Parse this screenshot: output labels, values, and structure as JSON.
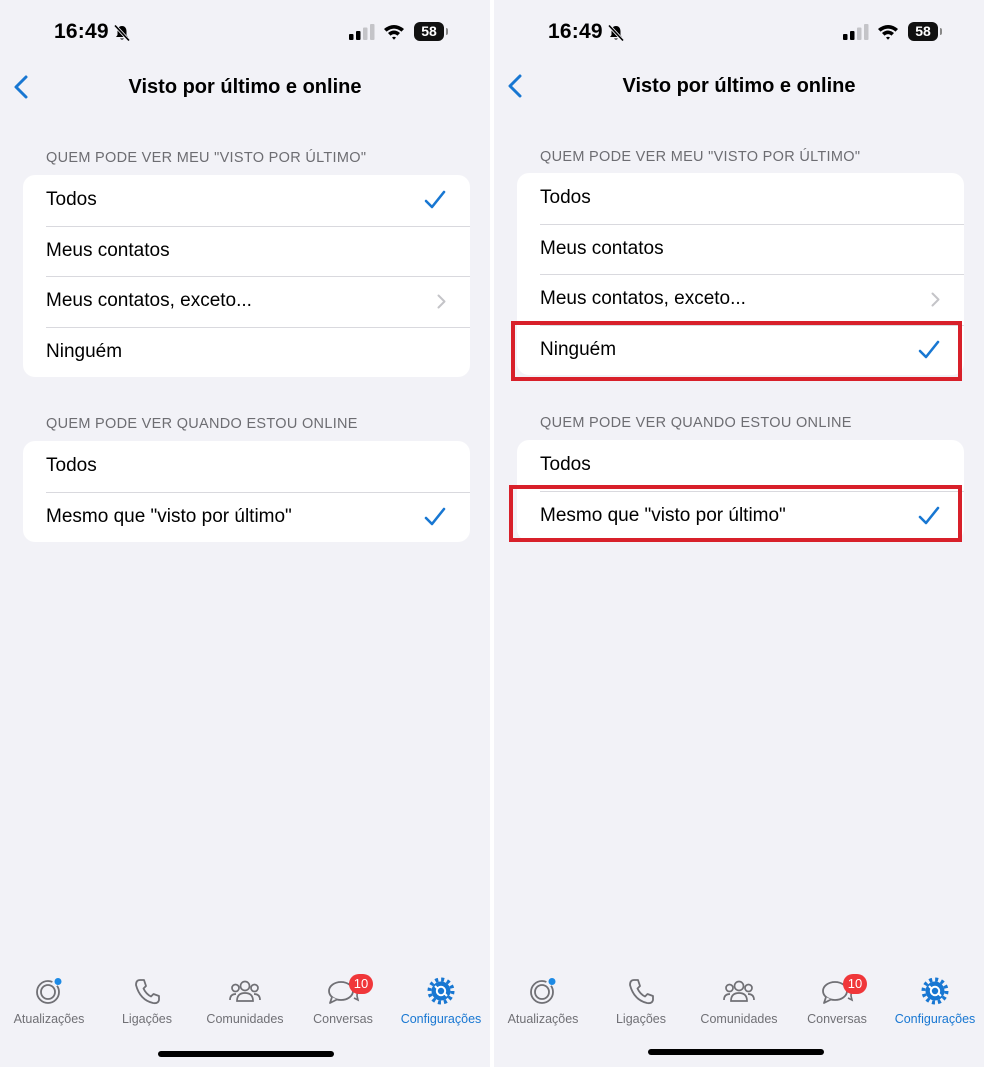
{
  "status": {
    "time": "16:49",
    "battery": "58"
  },
  "nav": {
    "title": "Visto por último e online"
  },
  "last_seen": {
    "header": "QUEM PODE VER MEU \"VISTO POR ÚLTIMO\"",
    "options": [
      "Todos",
      "Meus contatos",
      "Meus contatos, exceto...",
      "Ninguém"
    ]
  },
  "online": {
    "header": "QUEM PODE VER QUANDO ESTOU ONLINE",
    "options": [
      "Todos",
      "Mesmo que \"visto por último\""
    ]
  },
  "screens": [
    {
      "last_seen_selected": "Todos",
      "online_selected": "Mesmo que \"visto por último\""
    },
    {
      "last_seen_selected": "Ninguém",
      "online_selected": "Mesmo que \"visto por último\"",
      "highlighted": [
        "Ninguém",
        "Mesmo que \"visto por último\""
      ]
    }
  ],
  "tabs": [
    {
      "label": "Atualizações",
      "icon": "status-icon"
    },
    {
      "label": "Ligações",
      "icon": "phone-icon"
    },
    {
      "label": "Comunidades",
      "icon": "communities-icon"
    },
    {
      "label": "Conversas",
      "icon": "chats-icon",
      "badge": "10"
    },
    {
      "label": "Configurações",
      "icon": "settings-icon",
      "active": true
    }
  ],
  "colors": {
    "accent": "#1877d2",
    "badge": "#f0373a",
    "highlight": "#d8202a",
    "background": "#f2f2f7"
  }
}
